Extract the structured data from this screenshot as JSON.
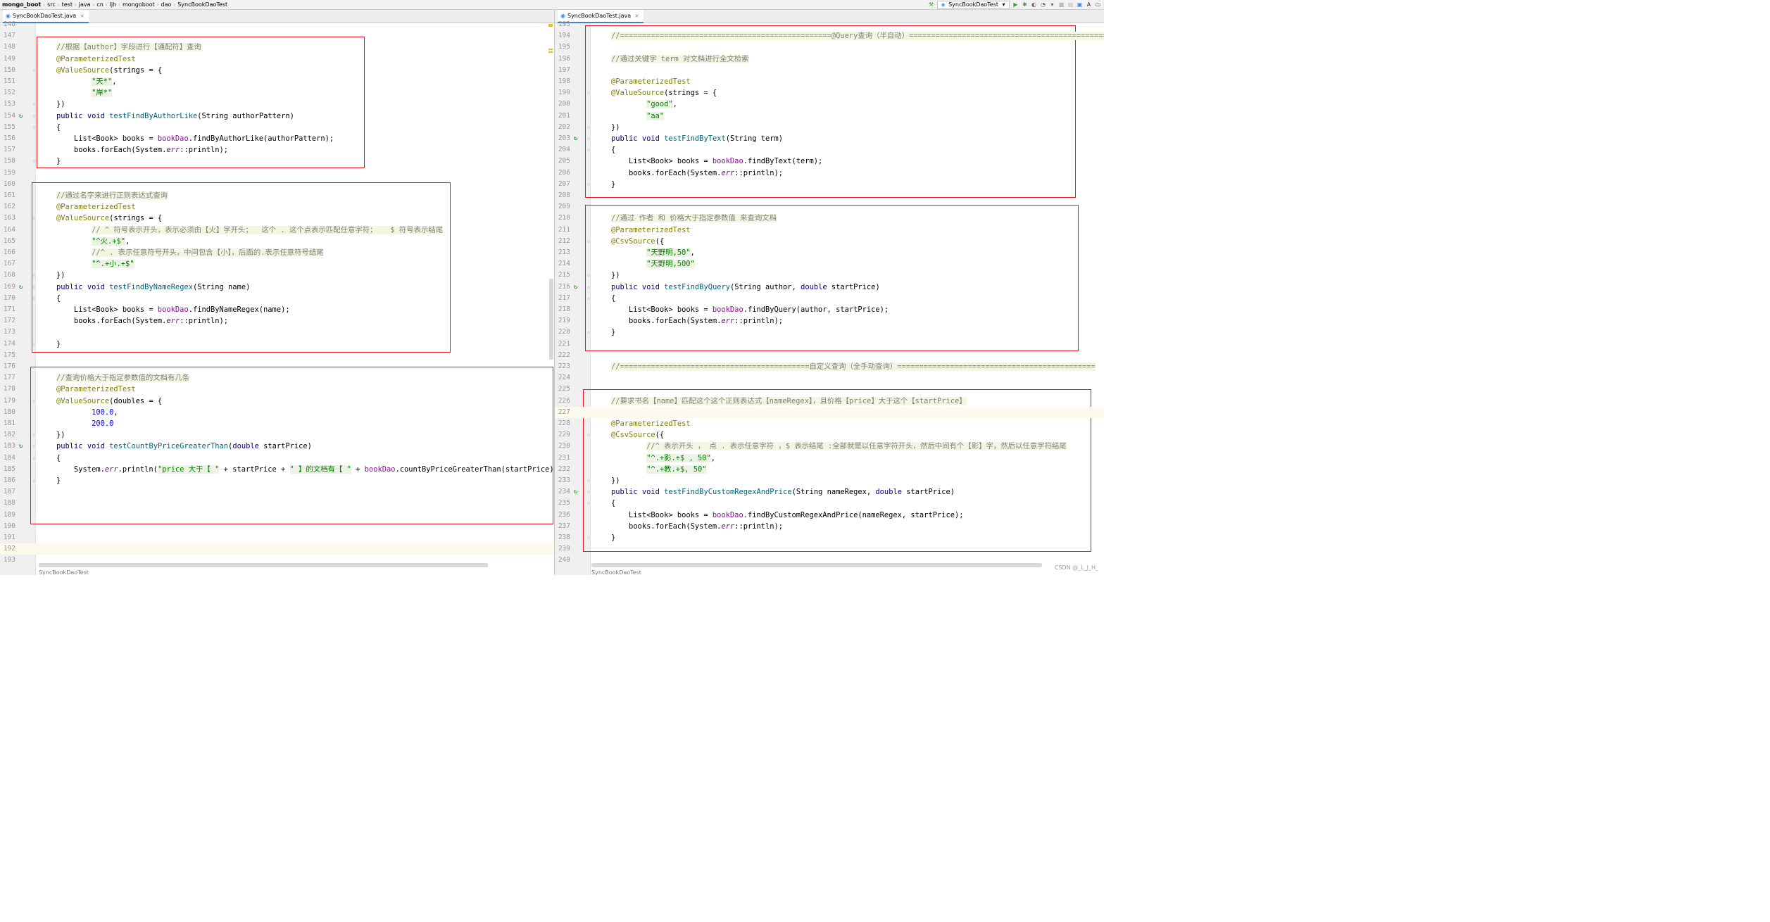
{
  "breadcrumb": [
    "mongo_boot",
    "src",
    "test",
    "java",
    "cn",
    "ljh",
    "mongoboot",
    "dao",
    "SyncBookDaoTest"
  ],
  "toolbar": {
    "run_config": "SyncBookDaoTest"
  },
  "colors": {
    "annotation_box": "#e8141e",
    "comment": "#808080",
    "annotation": "#808000",
    "keyword": "#000080",
    "string": "#008000",
    "field": "#871094"
  },
  "left_pane": {
    "tab": "SyncBookDaoTest.java",
    "bottom_tab": "SyncBookDaoTest",
    "lines": [
      {
        "n": "146",
        "t": ""
      },
      {
        "n": "147",
        "t": ""
      },
      {
        "n": "148",
        "t": "    //根据【author】字段进行【通配符】查询"
      },
      {
        "n": "149",
        "t": "    @ParameterizedTest"
      },
      {
        "n": "150",
        "t": "    @ValueSource(strings = {"
      },
      {
        "n": "151",
        "t": "            \"天*\","
      },
      {
        "n": "152",
        "t": "            \"岸*\""
      },
      {
        "n": "153",
        "t": "    })"
      },
      {
        "n": "154",
        "t": "    public void testFindByAuthorLike(String authorPattern)"
      },
      {
        "n": "155",
        "t": "    {"
      },
      {
        "n": "156",
        "t": "        List<Book> books = bookDao.findByAuthorLike(authorPattern);"
      },
      {
        "n": "157",
        "t": "        books.forEach(System.err::println);"
      },
      {
        "n": "158",
        "t": "    }"
      },
      {
        "n": "159",
        "t": ""
      },
      {
        "n": "160",
        "t": ""
      },
      {
        "n": "161",
        "t": "    //通过名字来进行正则表达式查询"
      },
      {
        "n": "162",
        "t": "    @ParameterizedTest"
      },
      {
        "n": "163",
        "t": "    @ValueSource(strings = {"
      },
      {
        "n": "164",
        "t": "            // ^ 符号表示开头，表示必须由【火】字开头；  这个 . 这个点表示匹配任意字符；   $ 符号表示结尾"
      },
      {
        "n": "165",
        "t": "            \"^火.+$\","
      },
      {
        "n": "166",
        "t": "            //^ . 表示任意符号开头，中间包含【小】，后面的.表示任意符号结尾"
      },
      {
        "n": "167",
        "t": "            \"^.+小.+$\""
      },
      {
        "n": "168",
        "t": "    })"
      },
      {
        "n": "169",
        "t": "    public void testFindByNameRegex(String name)"
      },
      {
        "n": "170",
        "t": "    {"
      },
      {
        "n": "171",
        "t": "        List<Book> books = bookDao.findByNameRegex(name);"
      },
      {
        "n": "172",
        "t": "        books.forEach(System.err::println);"
      },
      {
        "n": "173",
        "t": ""
      },
      {
        "n": "174",
        "t": "    }"
      },
      {
        "n": "175",
        "t": ""
      },
      {
        "n": "176",
        "t": ""
      },
      {
        "n": "177",
        "t": "    //查询价格大于指定参数值的文档有几条"
      },
      {
        "n": "178",
        "t": "    @ParameterizedTest"
      },
      {
        "n": "179",
        "t": "    @ValueSource(doubles = {"
      },
      {
        "n": "180",
        "t": "            100.0,"
      },
      {
        "n": "181",
        "t": "            200.0"
      },
      {
        "n": "182",
        "t": "    })"
      },
      {
        "n": "183",
        "t": "    public void testCountByPriceGreaterThan(double startPrice)"
      },
      {
        "n": "184",
        "t": "    {"
      },
      {
        "n": "185",
        "t": "        System.err.println(\"price 大于【 \" + startPrice + \" 】的文档有【 \" + bookDao.countByPriceGreaterThan(startPrice) + \" 】条\");"
      },
      {
        "n": "186",
        "t": "    }"
      },
      {
        "n": "187",
        "t": ""
      },
      {
        "n": "188",
        "t": ""
      },
      {
        "n": "189",
        "t": ""
      },
      {
        "n": "190",
        "t": ""
      },
      {
        "n": "191",
        "t": ""
      },
      {
        "n": "192",
        "t": ""
      },
      {
        "n": "193",
        "t": ""
      }
    ]
  },
  "right_pane": {
    "tab": "SyncBookDaoTest.java",
    "bottom_tab": "SyncBookDaoTest",
    "lines": [
      {
        "n": "193",
        "t": ""
      },
      {
        "n": "194",
        "t": "    //================================================@Query查询（半自动）=================================================="
      },
      {
        "n": "195",
        "t": ""
      },
      {
        "n": "196",
        "t": "    //通过关键字 term 对文档进行全文检索"
      },
      {
        "n": "197",
        "t": ""
      },
      {
        "n": "198",
        "t": "    @ParameterizedTest"
      },
      {
        "n": "199",
        "t": "    @ValueSource(strings = {"
      },
      {
        "n": "200",
        "t": "            \"good\","
      },
      {
        "n": "201",
        "t": "            \"aa\""
      },
      {
        "n": "202",
        "t": "    })"
      },
      {
        "n": "203",
        "t": "    public void testFindByText(String term)"
      },
      {
        "n": "204",
        "t": "    {"
      },
      {
        "n": "205",
        "t": "        List<Book> books = bookDao.findByText(term);"
      },
      {
        "n": "206",
        "t": "        books.forEach(System.err::println);"
      },
      {
        "n": "207",
        "t": "    }"
      },
      {
        "n": "208",
        "t": ""
      },
      {
        "n": "209",
        "t": ""
      },
      {
        "n": "210",
        "t": "    //通过 作者 和 价格大于指定参数值 来查询文档"
      },
      {
        "n": "211",
        "t": "    @ParameterizedTest"
      },
      {
        "n": "212",
        "t": "    @CsvSource({"
      },
      {
        "n": "213",
        "t": "            \"天野明,50\","
      },
      {
        "n": "214",
        "t": "            \"天野明,500\""
      },
      {
        "n": "215",
        "t": "    })"
      },
      {
        "n": "216",
        "t": "    public void testFindByQuery(String author, double startPrice)"
      },
      {
        "n": "217",
        "t": "    {"
      },
      {
        "n": "218",
        "t": "        List<Book> books = bookDao.findByQuery(author, startPrice);"
      },
      {
        "n": "219",
        "t": "        books.forEach(System.err::println);"
      },
      {
        "n": "220",
        "t": "    }"
      },
      {
        "n": "221",
        "t": ""
      },
      {
        "n": "222",
        "t": ""
      },
      {
        "n": "223",
        "t": "    //===========================================自定义查询（全手动查询）============================================="
      },
      {
        "n": "224",
        "t": ""
      },
      {
        "n": "225",
        "t": ""
      },
      {
        "n": "226",
        "t": "    //要求书名【name】匹配这个这个正则表达式【nameRegex】，且价格【price】大于这个【startPrice】"
      },
      {
        "n": "227",
        "t": ""
      },
      {
        "n": "228",
        "t": "    @ParameterizedTest"
      },
      {
        "n": "229",
        "t": "    @CsvSource({"
      },
      {
        "n": "230",
        "t": "            //^ 表示开头 ， 点 . 表示任意字符 ，$ 表示结尾 :全部就是以任意字符开头，然后中间有个【影】字，然后以任意字符结尾"
      },
      {
        "n": "231",
        "t": "            \"^.+影.+$ , 50\","
      },
      {
        "n": "232",
        "t": "            \"^.+教.+$, 50\""
      },
      {
        "n": "233",
        "t": "    })"
      },
      {
        "n": "234",
        "t": "    public void testFindByCustomRegexAndPrice(String nameRegex, double startPrice)"
      },
      {
        "n": "235",
        "t": "    {"
      },
      {
        "n": "236",
        "t": "        List<Book> books = bookDao.findByCustomRegexAndPrice(nameRegex, startPrice);"
      },
      {
        "n": "237",
        "t": "        books.forEach(System.err::println);"
      },
      {
        "n": "238",
        "t": "    }"
      },
      {
        "n": "239",
        "t": ""
      },
      {
        "n": "240",
        "t": ""
      }
    ]
  },
  "watermark": "CSDN @_L_J_H_"
}
